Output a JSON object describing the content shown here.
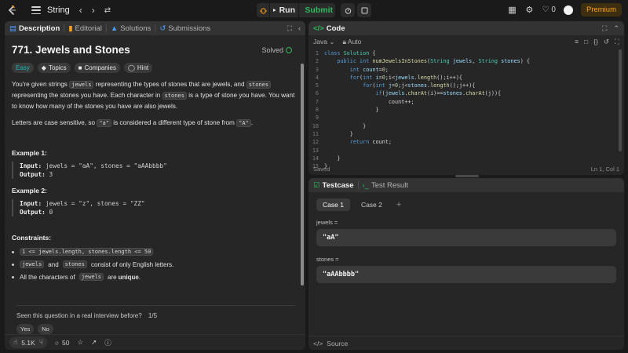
{
  "nav": {
    "problem_list_label": "String",
    "run_label": "Run",
    "submit_label": "Submit",
    "streak_count": "0",
    "premium_label": "Premium"
  },
  "description": {
    "tabs": [
      {
        "label": "Description"
      },
      {
        "label": "Editorial"
      },
      {
        "label": "Solutions"
      },
      {
        "label": "Submissions"
      }
    ],
    "title": "771. Jewels and Stones",
    "status": "Solved",
    "tags": [
      {
        "label": "Easy"
      },
      {
        "label": "Topics"
      },
      {
        "label": "Companies"
      },
      {
        "label": "Hint"
      }
    ],
    "p1": {
      "a": "You're given strings ",
      "b": "jewels",
      "c": " representing the types of stones that are jewels, and ",
      "d": "stones",
      "e": " representing the stones you have. Each character in ",
      "f": "stones",
      "g": " is a type of stone you have. You want to know how many of the stones you have are also jewels."
    },
    "p2": {
      "a": "Letters are case sensitive, so ",
      "b": "\"a\"",
      "c": " is considered a different type of stone from ",
      "d": "\"A\"",
      "e": "."
    },
    "examples": [
      {
        "heading": "Example 1:",
        "input_label": "Input:",
        "input": " jewels = \"aA\", stones = \"aAAbbbb\"",
        "output_label": "Output:",
        "output": " 3"
      },
      {
        "heading": "Example 2:",
        "input_label": "Input:",
        "input": " jewels = \"z\", stones = \"ZZ\"",
        "output_label": "Output:",
        "output": " 0"
      }
    ],
    "constraints_heading": "Constraints:",
    "constraints": {
      "c1_code": "1 <= jewels.length, stones.length <= 50",
      "c2_code1": "jewels",
      "c2_mid": "and",
      "c2_code2": "stones",
      "c2_tail": "consist of only English letters.",
      "c3_a": "All the characters of",
      "c3_code": "jewels",
      "c3_b": "are",
      "c3_bold": "unique",
      "c3_end": "."
    },
    "seen_question": "Seen this question in a real interview before?",
    "seen_count": "1/5",
    "yes_label": "Yes",
    "no_label": "No",
    "likes": "5.1K",
    "comments": "50"
  },
  "code_panel": {
    "title": "Code",
    "language": "Java",
    "autosave": "Auto",
    "status": "Saved",
    "cursor": "Ln 1, Col 1",
    "lines": [
      [
        {
          "t": "kw",
          "s": "class "
        },
        {
          "t": "tp",
          "s": "Solution"
        },
        {
          "t": "pl",
          "s": " {"
        }
      ],
      [
        {
          "t": "pl",
          "s": "    "
        },
        {
          "t": "kw",
          "s": "public int "
        },
        {
          "t": "fn",
          "s": "numJewelsInStones"
        },
        {
          "t": "pl",
          "s": "("
        },
        {
          "t": "tp",
          "s": "String"
        },
        {
          "t": "vr",
          "s": " jewels"
        },
        {
          "t": "pl",
          "s": ", "
        },
        {
          "t": "tp",
          "s": "String"
        },
        {
          "t": "vr",
          "s": " stones"
        },
        {
          "t": "pl",
          "s": ") {"
        }
      ],
      [
        {
          "t": "pl",
          "s": "        "
        },
        {
          "t": "kw",
          "s": "int "
        },
        {
          "t": "vr",
          "s": "count"
        },
        {
          "t": "pl",
          "s": "="
        },
        {
          "t": "nm",
          "s": "0"
        },
        {
          "t": "pl",
          "s": ";"
        }
      ],
      [
        {
          "t": "pl",
          "s": "        "
        },
        {
          "t": "kw",
          "s": "for"
        },
        {
          "t": "pl",
          "s": "("
        },
        {
          "t": "kw",
          "s": "int "
        },
        {
          "t": "vr",
          "s": "i"
        },
        {
          "t": "pl",
          "s": "="
        },
        {
          "t": "nm",
          "s": "0"
        },
        {
          "t": "pl",
          "s": ";i<"
        },
        {
          "t": "vr",
          "s": "jewels"
        },
        {
          "t": "pl",
          "s": "."
        },
        {
          "t": "fn",
          "s": "length"
        },
        {
          "t": "pl",
          "s": "();i++){"
        }
      ],
      [
        {
          "t": "pl",
          "s": "            "
        },
        {
          "t": "kw",
          "s": "for"
        },
        {
          "t": "pl",
          "s": "("
        },
        {
          "t": "kw",
          "s": "int "
        },
        {
          "t": "vr",
          "s": "j"
        },
        {
          "t": "pl",
          "s": "="
        },
        {
          "t": "nm",
          "s": "0"
        },
        {
          "t": "pl",
          "s": ";j<"
        },
        {
          "t": "vr",
          "s": "stones"
        },
        {
          "t": "pl",
          "s": "."
        },
        {
          "t": "fn",
          "s": "length"
        },
        {
          "t": "pl",
          "s": "();j++){"
        }
      ],
      [
        {
          "t": "pl",
          "s": "                "
        },
        {
          "t": "kw",
          "s": "if"
        },
        {
          "t": "pl",
          "s": "("
        },
        {
          "t": "vr",
          "s": "jewels"
        },
        {
          "t": "pl",
          "s": "."
        },
        {
          "t": "fn",
          "s": "charAt"
        },
        {
          "t": "pl",
          "s": "(i)=="
        },
        {
          "t": "vr",
          "s": "stones"
        },
        {
          "t": "pl",
          "s": "."
        },
        {
          "t": "fn",
          "s": "charAt"
        },
        {
          "t": "pl",
          "s": "(j)){"
        }
      ],
      [
        {
          "t": "pl",
          "s": "                    count++;"
        }
      ],
      [
        {
          "t": "pl",
          "s": "                }"
        }
      ],
      [
        {
          "t": "pl",
          "s": ""
        }
      ],
      [
        {
          "t": "pl",
          "s": "            }"
        }
      ],
      [
        {
          "t": "pl",
          "s": "        }"
        }
      ],
      [
        {
          "t": "pl",
          "s": "        "
        },
        {
          "t": "kw",
          "s": "return "
        },
        {
          "t": "pl",
          "s": "count;"
        }
      ],
      [
        {
          "t": "pl",
          "s": ""
        }
      ],
      [
        {
          "t": "pl",
          "s": "    }"
        }
      ],
      [
        {
          "t": "pl",
          "s": "}"
        }
      ]
    ]
  },
  "tests_panel": {
    "tab_testcase": "Testcase",
    "tab_result": "Test Result",
    "cases": [
      {
        "label": "Case 1"
      },
      {
        "label": "Case 2"
      }
    ],
    "fields": [
      {
        "label": "jewels =",
        "value": "\"aA\""
      },
      {
        "label": "stones =",
        "value": "\"aAAbbbb\""
      }
    ],
    "source_label": "Source"
  },
  "colors": {
    "accent_green": "#2cbb5d",
    "premium": "#ffa116",
    "easy": "#1cb8b8"
  }
}
